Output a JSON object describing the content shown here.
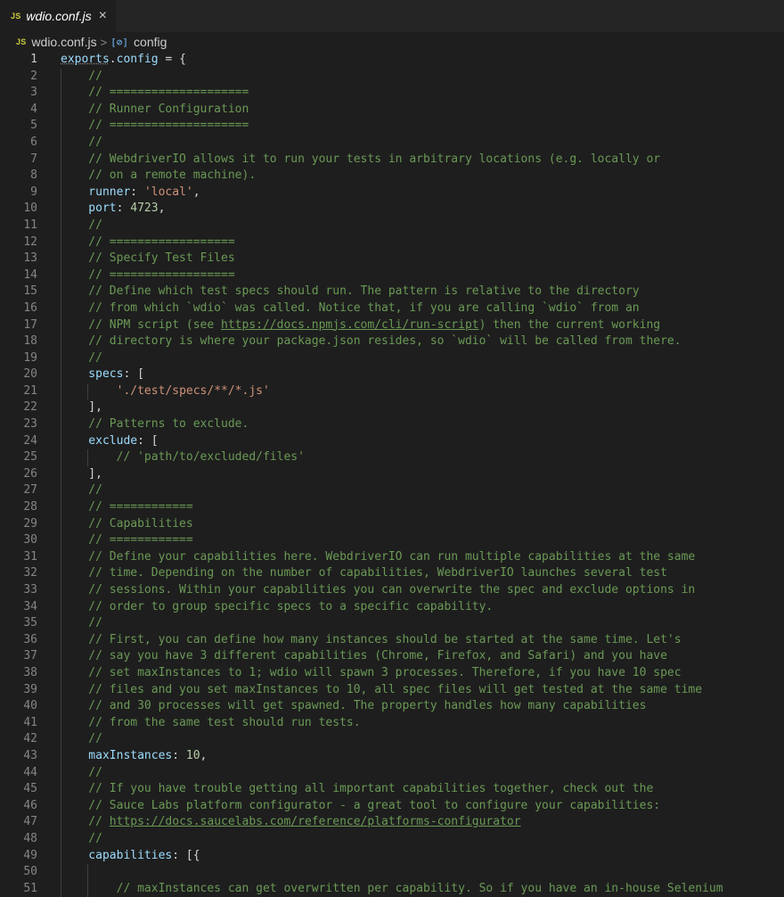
{
  "tab": {
    "icon": "JS",
    "title": "wdio.conf.js",
    "close": "×"
  },
  "breadcrumb": {
    "file_icon": "JS",
    "file": "wdio.conf.js",
    "separator": ">",
    "symbol_icon": "[⊘]",
    "symbol": "config"
  },
  "lines": [
    {
      "n": "1",
      "indent": 0,
      "segs": [
        {
          "t": "exports",
          "c": "kw wave"
        },
        {
          "t": ".",
          "c": "pn"
        },
        {
          "t": "config",
          "c": "kw"
        },
        {
          "t": " = {",
          "c": "pn"
        }
      ]
    },
    {
      "n": "2",
      "indent": 1,
      "segs": [
        {
          "t": "    //",
          "c": "cm"
        }
      ]
    },
    {
      "n": "3",
      "indent": 1,
      "segs": [
        {
          "t": "    // ====================",
          "c": "cm"
        }
      ]
    },
    {
      "n": "4",
      "indent": 1,
      "segs": [
        {
          "t": "    // Runner Configuration",
          "c": "cm"
        }
      ]
    },
    {
      "n": "5",
      "indent": 1,
      "segs": [
        {
          "t": "    // ====================",
          "c": "cm"
        }
      ]
    },
    {
      "n": "6",
      "indent": 1,
      "segs": [
        {
          "t": "    //",
          "c": "cm"
        }
      ]
    },
    {
      "n": "7",
      "indent": 1,
      "segs": [
        {
          "t": "    // WebdriverIO allows it to run your tests in arbitrary locations (e.g. locally or",
          "c": "cm"
        }
      ]
    },
    {
      "n": "8",
      "indent": 1,
      "segs": [
        {
          "t": "    // on a remote machine).",
          "c": "cm"
        }
      ]
    },
    {
      "n": "9",
      "indent": 1,
      "segs": [
        {
          "t": "    runner",
          "c": "pr"
        },
        {
          "t": ": ",
          "c": "pn"
        },
        {
          "t": "'local'",
          "c": "st"
        },
        {
          "t": ",",
          "c": "pn"
        }
      ]
    },
    {
      "n": "10",
      "indent": 1,
      "segs": [
        {
          "t": "    port",
          "c": "pr"
        },
        {
          "t": ": ",
          "c": "pn"
        },
        {
          "t": "4723",
          "c": "nm"
        },
        {
          "t": ",",
          "c": "pn"
        }
      ]
    },
    {
      "n": "11",
      "indent": 1,
      "segs": [
        {
          "t": "    //",
          "c": "cm"
        }
      ]
    },
    {
      "n": "12",
      "indent": 1,
      "segs": [
        {
          "t": "    // ==================",
          "c": "cm"
        }
      ]
    },
    {
      "n": "13",
      "indent": 1,
      "segs": [
        {
          "t": "    // Specify Test Files",
          "c": "cm"
        }
      ]
    },
    {
      "n": "14",
      "indent": 1,
      "segs": [
        {
          "t": "    // ==================",
          "c": "cm"
        }
      ]
    },
    {
      "n": "15",
      "indent": 1,
      "segs": [
        {
          "t": "    // Define which test specs should run. The pattern is relative to the directory",
          "c": "cm"
        }
      ]
    },
    {
      "n": "16",
      "indent": 1,
      "segs": [
        {
          "t": "    // from which `wdio` was called. Notice that, if you are calling `wdio` from an",
          "c": "cm"
        }
      ]
    },
    {
      "n": "17",
      "indent": 1,
      "segs": [
        {
          "t": "    // NPM script (see ",
          "c": "cm"
        },
        {
          "t": "https://docs.npmjs.com/cli/run-script",
          "c": "cm ul"
        },
        {
          "t": ") then the current working",
          "c": "cm"
        }
      ]
    },
    {
      "n": "18",
      "indent": 1,
      "segs": [
        {
          "t": "    // directory is where your package.json resides, so `wdio` will be called from there.",
          "c": "cm"
        }
      ]
    },
    {
      "n": "19",
      "indent": 1,
      "segs": [
        {
          "t": "    //",
          "c": "cm"
        }
      ]
    },
    {
      "n": "20",
      "indent": 1,
      "segs": [
        {
          "t": "    specs",
          "c": "pr"
        },
        {
          "t": ": [",
          "c": "pn"
        }
      ]
    },
    {
      "n": "21",
      "indent": 2,
      "segs": [
        {
          "t": "        ",
          "c": "pn"
        },
        {
          "t": "'./test/specs/**/*.js'",
          "c": "st"
        }
      ]
    },
    {
      "n": "22",
      "indent": 1,
      "segs": [
        {
          "t": "    ],",
          "c": "pn"
        }
      ]
    },
    {
      "n": "23",
      "indent": 1,
      "segs": [
        {
          "t": "    // Patterns to exclude.",
          "c": "cm"
        }
      ]
    },
    {
      "n": "24",
      "indent": 1,
      "segs": [
        {
          "t": "    exclude",
          "c": "pr"
        },
        {
          "t": ": [",
          "c": "pn"
        }
      ]
    },
    {
      "n": "25",
      "indent": 2,
      "segs": [
        {
          "t": "        // 'path/to/excluded/files'",
          "c": "cm"
        }
      ]
    },
    {
      "n": "26",
      "indent": 1,
      "segs": [
        {
          "t": "    ],",
          "c": "pn"
        }
      ]
    },
    {
      "n": "27",
      "indent": 1,
      "segs": [
        {
          "t": "    //",
          "c": "cm"
        }
      ]
    },
    {
      "n": "28",
      "indent": 1,
      "segs": [
        {
          "t": "    // ============",
          "c": "cm"
        }
      ]
    },
    {
      "n": "29",
      "indent": 1,
      "segs": [
        {
          "t": "    // Capabilities",
          "c": "cm"
        }
      ]
    },
    {
      "n": "30",
      "indent": 1,
      "segs": [
        {
          "t": "    // ============",
          "c": "cm"
        }
      ]
    },
    {
      "n": "31",
      "indent": 1,
      "segs": [
        {
          "t": "    // Define your capabilities here. WebdriverIO can run multiple capabilities at the same",
          "c": "cm"
        }
      ]
    },
    {
      "n": "32",
      "indent": 1,
      "segs": [
        {
          "t": "    // time. Depending on the number of capabilities, WebdriverIO launches several test",
          "c": "cm"
        }
      ]
    },
    {
      "n": "33",
      "indent": 1,
      "segs": [
        {
          "t": "    // sessions. Within your capabilities you can overwrite the spec and exclude options in",
          "c": "cm"
        }
      ]
    },
    {
      "n": "34",
      "indent": 1,
      "segs": [
        {
          "t": "    // order to group specific specs to a specific capability.",
          "c": "cm"
        }
      ]
    },
    {
      "n": "35",
      "indent": 1,
      "segs": [
        {
          "t": "    //",
          "c": "cm"
        }
      ]
    },
    {
      "n": "36",
      "indent": 1,
      "segs": [
        {
          "t": "    // First, you can define how many instances should be started at the same time. Let's",
          "c": "cm"
        }
      ]
    },
    {
      "n": "37",
      "indent": 1,
      "segs": [
        {
          "t": "    // say you have 3 different capabilities (Chrome, Firefox, and Safari) and you have",
          "c": "cm"
        }
      ]
    },
    {
      "n": "38",
      "indent": 1,
      "segs": [
        {
          "t": "    // set maxInstances to 1; wdio will spawn 3 processes. Therefore, if you have 10 spec",
          "c": "cm"
        }
      ]
    },
    {
      "n": "39",
      "indent": 1,
      "segs": [
        {
          "t": "    // files and you set maxInstances to 10, all spec files will get tested at the same time",
          "c": "cm"
        }
      ]
    },
    {
      "n": "40",
      "indent": 1,
      "segs": [
        {
          "t": "    // and 30 processes will get spawned. The property handles how many capabilities",
          "c": "cm"
        }
      ]
    },
    {
      "n": "41",
      "indent": 1,
      "segs": [
        {
          "t": "    // from the same test should run tests.",
          "c": "cm"
        }
      ]
    },
    {
      "n": "42",
      "indent": 1,
      "segs": [
        {
          "t": "    //",
          "c": "cm"
        }
      ]
    },
    {
      "n": "43",
      "indent": 1,
      "segs": [
        {
          "t": "    maxInstances",
          "c": "pr"
        },
        {
          "t": ": ",
          "c": "pn"
        },
        {
          "t": "10",
          "c": "nm"
        },
        {
          "t": ",",
          "c": "pn"
        }
      ]
    },
    {
      "n": "44",
      "indent": 1,
      "segs": [
        {
          "t": "    //",
          "c": "cm"
        }
      ]
    },
    {
      "n": "45",
      "indent": 1,
      "segs": [
        {
          "t": "    // If you have trouble getting all important capabilities together, check out the",
          "c": "cm"
        }
      ]
    },
    {
      "n": "46",
      "indent": 1,
      "segs": [
        {
          "t": "    // Sauce Labs platform configurator - a great tool to configure your capabilities:",
          "c": "cm"
        }
      ]
    },
    {
      "n": "47",
      "indent": 1,
      "segs": [
        {
          "t": "    // ",
          "c": "cm"
        },
        {
          "t": "https://docs.saucelabs.com/reference/platforms-configurator",
          "c": "cm ul"
        }
      ]
    },
    {
      "n": "48",
      "indent": 1,
      "segs": [
        {
          "t": "    //",
          "c": "cm"
        }
      ]
    },
    {
      "n": "49",
      "indent": 1,
      "segs": [
        {
          "t": "    capabilities",
          "c": "pr"
        },
        {
          "t": ": [{",
          "c": "pn"
        }
      ]
    },
    {
      "n": "50",
      "indent": 2,
      "segs": [
        {
          "t": "",
          "c": "pn"
        }
      ]
    },
    {
      "n": "51",
      "indent": 2,
      "segs": [
        {
          "t": "        // maxInstances can get overwritten per capability. So if you have an in-house Selenium",
          "c": "cm"
        }
      ]
    }
  ]
}
